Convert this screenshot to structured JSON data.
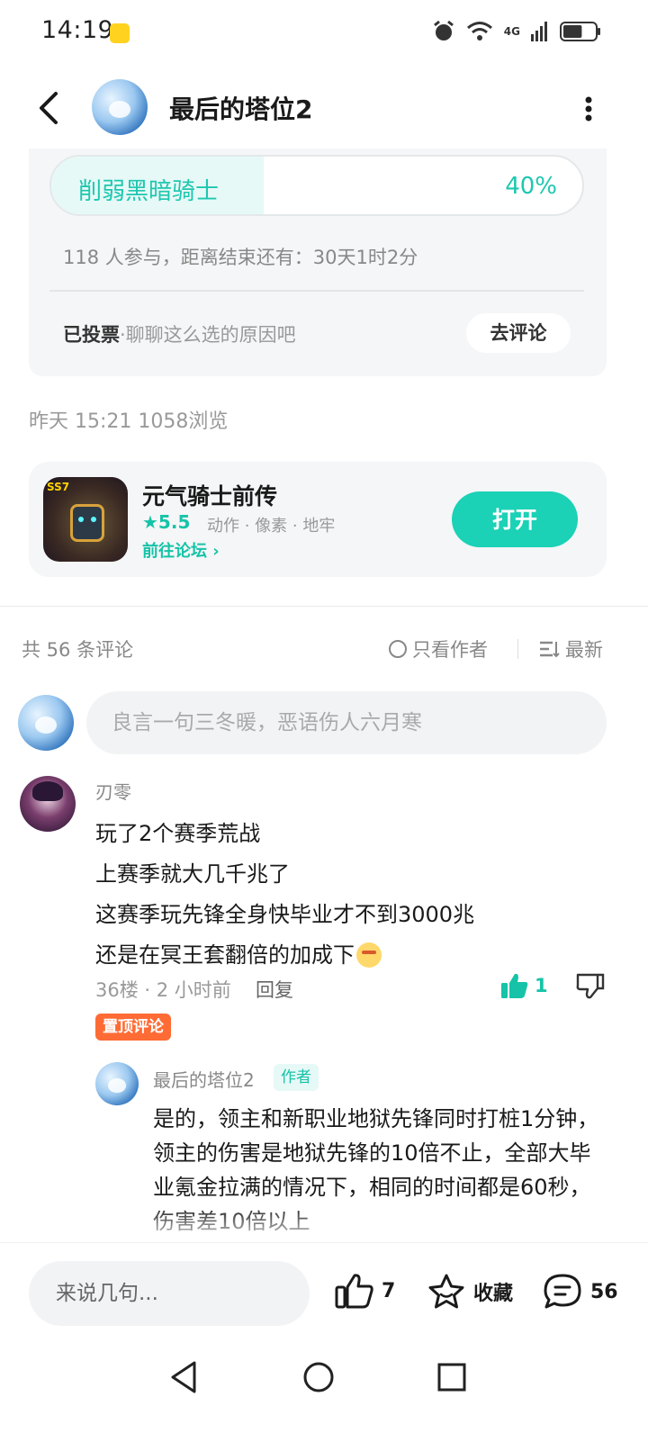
{
  "status_bar": {
    "time": "14:19",
    "network": "4G",
    "battery_level": 0.6
  },
  "header": {
    "title": "最后的塔位2"
  },
  "vote": {
    "option_label": "削弱黑暗骑士",
    "option_percent_text": "40%",
    "option_fraction": 0.4,
    "meta": "118 人参与，距离结束还有：30天1时2分",
    "voted_label": "已投票",
    "voted_prompt": "·聊聊这么选的原因吧",
    "comment_button": "去评论"
  },
  "post": {
    "time_views": "昨天 15:21  1058浏览"
  },
  "game": {
    "icon_badge": "SS7",
    "name": "元气骑士前传",
    "rating": "★5.5",
    "tags": "动作 · 像素 · 地牢",
    "forum_link": "前往论坛 ›",
    "open_button": "打开"
  },
  "comments_header": {
    "count": "共 56 条评论",
    "author_only": "只看作者",
    "sort": "最新"
  },
  "comment_input": {
    "placeholder": "良言一句三冬暖，恶语伤人六月寒"
  },
  "comment": {
    "user": "刃零",
    "lines": [
      "玩了2个赛季荒战",
      "上赛季就大几千兆了",
      "这赛季玩先锋全身快毕业才不到3000兆",
      "还是在冥王套翻倍的加成下"
    ],
    "meta": "36楼 · 2 小时前",
    "reply_label": "回复",
    "likes": "1",
    "pinned_badge": "置顶评论"
  },
  "reply": {
    "user": "最后的塔位2",
    "author_tag": "作者",
    "text": "是的，领主和新职业地狱先锋同时打桩1分钟，领主的伤害是地狱先锋的10倍不止，全部大毕业氪金拉满的情况下，相同的时间都是60秒，伤害差10倍以上"
  },
  "bottom_bar": {
    "input_placeholder": "来说几句...",
    "like_count": "7",
    "favorite_label": "收藏",
    "comment_count": "56"
  },
  "colors": {
    "accent": "#1bd1b6",
    "pin": "#ff6b35"
  }
}
